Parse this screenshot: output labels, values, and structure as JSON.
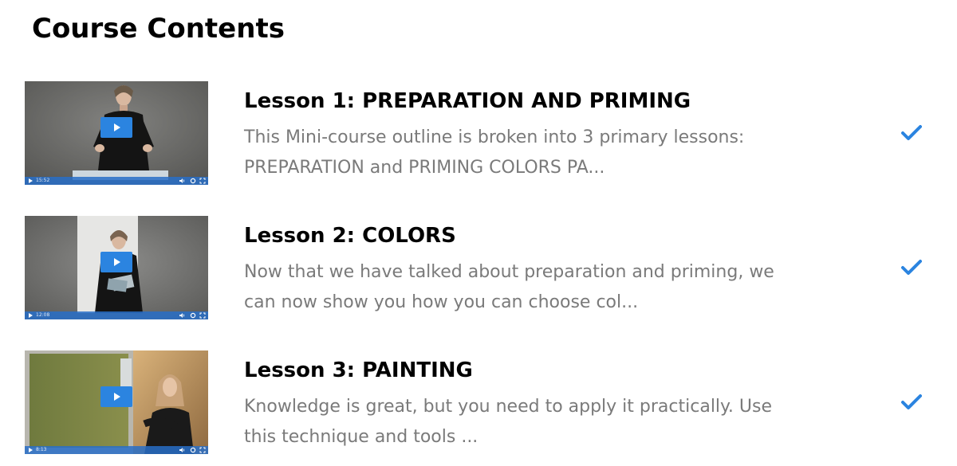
{
  "page": {
    "title": "Course Contents"
  },
  "colors": {
    "accent": "#2b84e0",
    "title": "#000000",
    "description": "#7a7a7a"
  },
  "lessons": [
    {
      "title": "Lesson 1: PREPARATION AND PRIMING",
      "description": "This Mini-course outline is broken into 3 primary lessons: PREPARATION and PRIMING COLORS PA...",
      "completed": true,
      "video_time": "15:52",
      "thumbnail_icon": "video-thumbnail"
    },
    {
      "title": "Lesson 2: COLORS",
      "description": "Now that we have talked about preparation and priming, we can now show you how you can choose col...",
      "completed": true,
      "video_time": "12:08",
      "thumbnail_icon": "video-thumbnail"
    },
    {
      "title": "Lesson 3: PAINTING",
      "description": "Knowledge is great, but you need to apply it practically. Use this technique and tools ...",
      "completed": true,
      "video_time": "8:13",
      "thumbnail_icon": "video-thumbnail"
    }
  ]
}
